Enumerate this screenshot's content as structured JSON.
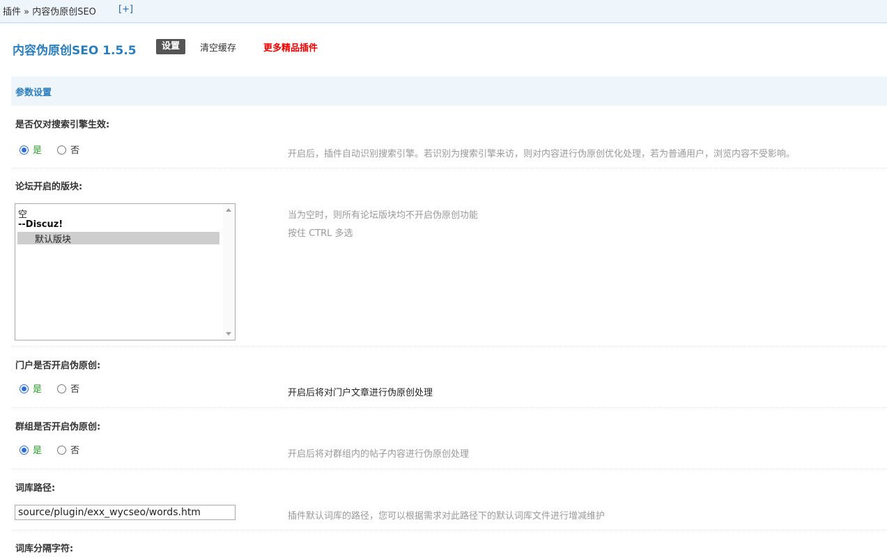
{
  "breadcrumb": {
    "text": "插件 » 内容伪原创SEO",
    "add_label": "[+]"
  },
  "header": {
    "title": "内容伪原创SEO 1.5.5",
    "tabs": [
      {
        "label": "设置",
        "active": true
      },
      {
        "label": "清空缓存",
        "active": false
      },
      {
        "label": "更多精品插件",
        "active": false
      }
    ]
  },
  "section": {
    "title": "参数设置"
  },
  "settings": {
    "search_only": {
      "label": "是否仅对搜索引擎生效:",
      "yes": "是",
      "no": "否",
      "selected": "yes",
      "desc": "开启后，插件自动识别搜索引擎。若识别为搜索引擎来访，则对内容进行伪原创优化处理，若为普通用户，浏览内容不受影响。"
    },
    "forums": {
      "label": "论坛开启的版块:",
      "options": [
        "空",
        "--Discuz!",
        "默认版块"
      ],
      "selected": "默认版块",
      "desc1": "当为空时，则所有论坛版块均不开启伪原创功能",
      "desc2": "按住 CTRL 多选"
    },
    "portal": {
      "label": "门户是否开启伪原创:",
      "yes": "是",
      "no": "否",
      "selected": "yes",
      "desc": "开启后将对门户文章进行伪原创处理"
    },
    "group": {
      "label": "群组是否开启伪原创:",
      "yes": "是",
      "no": "否",
      "selected": "yes",
      "desc": "开启后将对群组内的帖子内容进行伪原创处理"
    },
    "dict_path": {
      "label": "词库路径:",
      "value": "source/plugin/exx_wycseo/words.htm",
      "desc": "插件默认词库的路径，您可以根据需求对此路径下的默认词库文件进行增减维护"
    },
    "separator": {
      "label": "词库分隔字符:"
    }
  },
  "colors": {
    "accent": "#2b7dbc",
    "yes": "#2da02d",
    "more": "#e00000",
    "active_tab": "#555555"
  }
}
